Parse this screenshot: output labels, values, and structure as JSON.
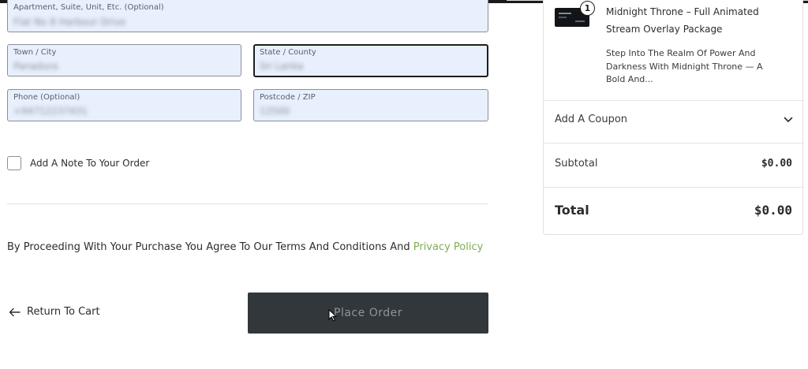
{
  "form": {
    "apartment": {
      "label": "Apartment, Suite, Unit, Etc. (Optional)",
      "value": "Flat No 8 Harbour Drive"
    },
    "town": {
      "label": "Town / City",
      "value": "Panadura"
    },
    "state": {
      "label": "State / County",
      "value": "Sri Lanka"
    },
    "phone": {
      "label": "Phone (Optional)",
      "value": "+94712237431"
    },
    "postcode": {
      "label": "Postcode / ZIP",
      "value": "12500"
    },
    "note_checkbox_label": "Add A Note To Your Order"
  },
  "terms": {
    "text": "By Proceeding With Your Purchase You Agree To Our Terms And Conditions And ",
    "link": "Privacy Policy"
  },
  "actions": {
    "return_label": "Return To Cart",
    "place_order_label": "Place Order"
  },
  "summary": {
    "product_name": "Midnight Throne – Full Animated Stream Overlay Package",
    "product_description": "Step Into The Realm Of Power And Darkness With Midnight Throne — A Bold And...",
    "quantity": "1",
    "coupon_label": "Add A Coupon",
    "subtotal_label": "Subtotal",
    "subtotal_value": "$0.00",
    "total_label": "Total",
    "total_value": "$0.00"
  },
  "icons": {
    "return": "arrow-left-icon",
    "coupon": "chevron-down-icon",
    "cursor": "mouse-pointer-icon"
  }
}
